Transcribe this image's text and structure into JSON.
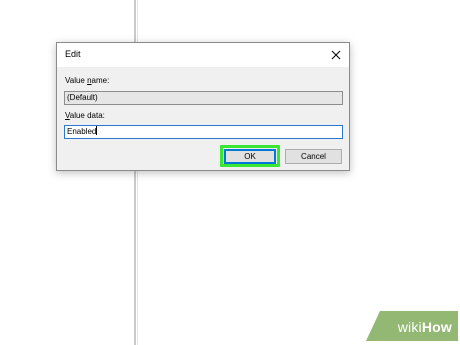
{
  "dialog": {
    "title": "Edit",
    "close_icon": "close-icon",
    "value_name": {
      "label_pre": "Value ",
      "label_accel": "n",
      "label_post": "ame:",
      "value": "(Default)"
    },
    "value_data": {
      "label_accel": "V",
      "label_post": "alue data:",
      "value": "Enabled"
    },
    "buttons": {
      "ok": "OK",
      "cancel": "Cancel"
    }
  },
  "watermark": {
    "part1": "wiki",
    "part2": "How"
  },
  "colors": {
    "highlight": "#39e632",
    "focus_blue": "#0078d7",
    "watermark_green": "#93b874"
  }
}
